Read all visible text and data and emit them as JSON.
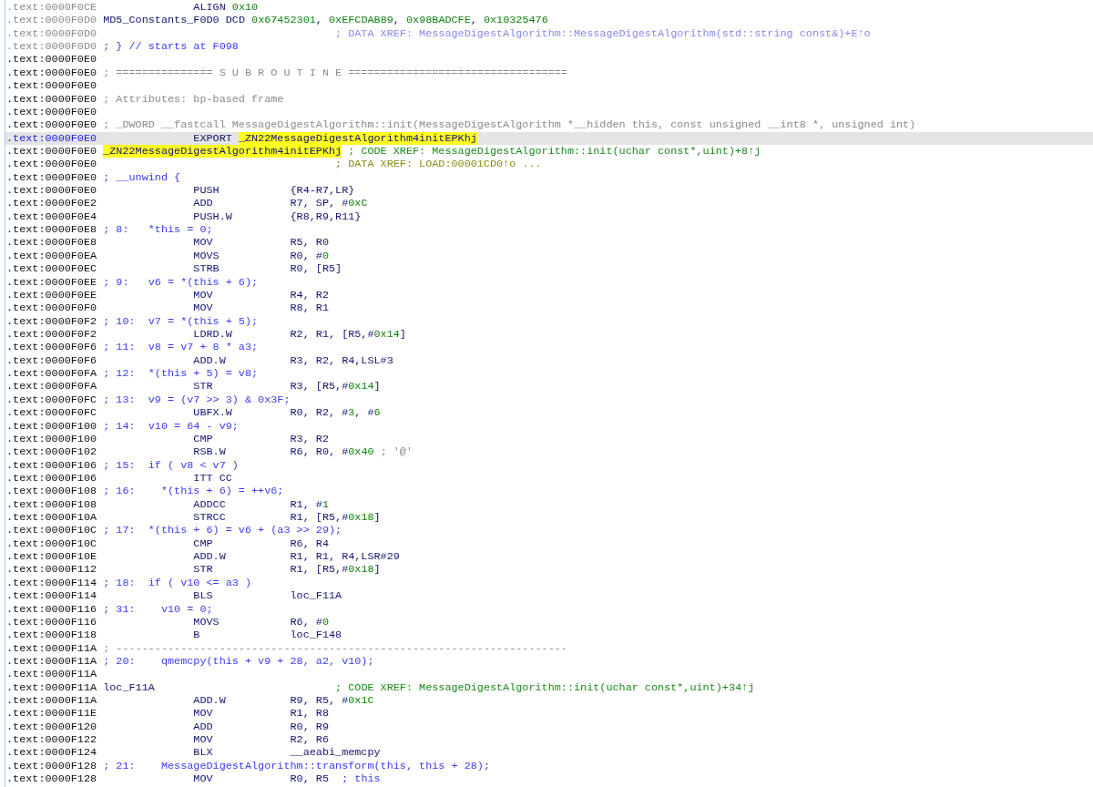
{
  "listing": {
    "lines": [
      {
        "address": ".text:0000F0CE",
        "dimmed": true,
        "selected": false,
        "parts": [
          {
            "kind": "directive",
            "text": "ALIGN"
          },
          {
            "kind": "data",
            "tokens": [
              {
                "kind": "num",
                "text": "0x10"
              }
            ]
          }
        ]
      },
      {
        "address": ".text:0000F0D0",
        "dimmed": true,
        "selected": false,
        "parts": [
          {
            "kind": "label",
            "text": "MD5_Constants_F0D0"
          },
          {
            "kind": "data",
            "tokens": [
              {
                "kind": "reg",
                "text": "DCD "
              },
              {
                "kind": "num",
                "text": "0x67452301"
              },
              {
                "kind": "reg",
                "text": ", "
              },
              {
                "kind": "num",
                "text": "0xEFCDAB89"
              },
              {
                "kind": "reg",
                "text": ", "
              },
              {
                "kind": "num",
                "text": "0x98BADCFE"
              },
              {
                "kind": "reg",
                "text": ", "
              },
              {
                "kind": "num",
                "text": "0x10325476"
              }
            ]
          }
        ]
      },
      {
        "address": ".text:0000F0D0",
        "dimmed": true,
        "selected": false,
        "parts": [
          {
            "kind": "xref-dim",
            "text": "; DATA XREF: MessageDigestAlgorithm::MessageDigestAlgorithm(std::string const&)+E↑o"
          }
        ]
      },
      {
        "address": ".text:0000F0D0",
        "dimmed": true,
        "selected": false,
        "parts": [
          {
            "kind": "pseudo",
            "text": "; } // starts at F098"
          }
        ]
      },
      {
        "address": ".text:0000F0E0",
        "dimmed": false,
        "selected": false
      },
      {
        "address": ".text:0000F0E0",
        "dimmed": false,
        "selected": false,
        "parts": [
          {
            "kind": "note",
            "text": "; =============== S U B R O U T I N E =================================="
          }
        ]
      },
      {
        "address": ".text:0000F0E0",
        "dimmed": false,
        "selected": false
      },
      {
        "address": ".text:0000F0E0",
        "dimmed": false,
        "selected": false,
        "parts": [
          {
            "kind": "note",
            "text": "; Attributes: bp-based frame"
          }
        ]
      },
      {
        "address": ".text:0000F0E0",
        "dimmed": false,
        "selected": false
      },
      {
        "address": ".text:0000F0E0",
        "dimmed": false,
        "selected": false,
        "parts": [
          {
            "kind": "note",
            "text": "; _DWORD __fastcall MessageDigestAlgorithm::init(MessageDigestAlgorithm *__hidden this, const unsigned __int8 *, unsigned int)"
          }
        ]
      },
      {
        "address": ".text:0000F0E0",
        "dimmed": false,
        "selected": true,
        "parts": [
          {
            "kind": "directive",
            "text": "EXPORT"
          },
          {
            "kind": "highlight",
            "text": "_ZN22MessageDigestAlgorithm4initEPKhj"
          }
        ]
      },
      {
        "address": ".text:0000F0E0",
        "dimmed": false,
        "selected": false,
        "parts": [
          {
            "kind": "highlight-label",
            "text": "_ZN22MessageDigestAlgorithm4initEPKhj"
          },
          {
            "kind": "xref",
            "text": "; CODE XREF: MessageDigestAlgorithm::init(uchar const*,uint)+8↑j"
          }
        ]
      },
      {
        "address": ".text:0000F0E0",
        "dimmed": false,
        "selected": false,
        "parts": [
          {
            "kind": "xref-data",
            "text": "; DATA XREF: LOAD:00001CD0↑o ..."
          }
        ]
      },
      {
        "address": ".text:0000F0E0",
        "dimmed": false,
        "selected": false,
        "parts": [
          {
            "kind": "pseudo",
            "text": "; __unwind {"
          }
        ]
      },
      {
        "address": ".text:0000F0E0",
        "dimmed": false,
        "selected": false,
        "parts": [
          {
            "kind": "mnemonic",
            "text": "PUSH"
          },
          {
            "kind": "operands",
            "tokens": [
              {
                "kind": "reg",
                "text": "{R4-R7,LR}"
              }
            ]
          }
        ]
      },
      {
        "address": ".text:0000F0E2",
        "dimmed": false,
        "selected": false,
        "parts": [
          {
            "kind": "mnemonic",
            "text": "ADD"
          },
          {
            "kind": "operands",
            "tokens": [
              {
                "kind": "reg",
                "text": "R7, SP, #"
              },
              {
                "kind": "num",
                "text": "0xC"
              }
            ]
          }
        ]
      },
      {
        "address": ".text:0000F0E4",
        "dimmed": false,
        "selected": false,
        "parts": [
          {
            "kind": "mnemonic",
            "text": "PUSH.W"
          },
          {
            "kind": "operands",
            "tokens": [
              {
                "kind": "reg",
                "text": "{R8,R9,R11}"
              }
            ]
          }
        ]
      },
      {
        "address": ".text:0000F0E8",
        "dimmed": false,
        "selected": false,
        "parts": [
          {
            "kind": "pseudo",
            "text": "; 8:   *this = 0;"
          }
        ]
      },
      {
        "address": ".text:0000F0E8",
        "dimmed": false,
        "selected": false,
        "parts": [
          {
            "kind": "mnemonic",
            "text": "MOV"
          },
          {
            "kind": "operands",
            "tokens": [
              {
                "kind": "reg",
                "text": "R5, R0"
              }
            ]
          }
        ]
      },
      {
        "address": ".text:0000F0EA",
        "dimmed": false,
        "selected": false,
        "parts": [
          {
            "kind": "mnemonic",
            "text": "MOVS"
          },
          {
            "kind": "operands",
            "tokens": [
              {
                "kind": "reg",
                "text": "R0, #"
              },
              {
                "kind": "num",
                "text": "0"
              }
            ]
          }
        ]
      },
      {
        "address": ".text:0000F0EC",
        "dimmed": false,
        "selected": false,
        "parts": [
          {
            "kind": "mnemonic",
            "text": "STRB"
          },
          {
            "kind": "operands",
            "tokens": [
              {
                "kind": "reg",
                "text": "R0, [R5]"
              }
            ]
          }
        ]
      },
      {
        "address": ".text:0000F0EE",
        "dimmed": false,
        "selected": false,
        "parts": [
          {
            "kind": "pseudo",
            "text": "; 9:   v6 = *(this + 6);"
          }
        ]
      },
      {
        "address": ".text:0000F0EE",
        "dimmed": false,
        "selected": false,
        "parts": [
          {
            "kind": "mnemonic",
            "text": "MOV"
          },
          {
            "kind": "operands",
            "tokens": [
              {
                "kind": "reg",
                "text": "R4, R2"
              }
            ]
          }
        ]
      },
      {
        "address": ".text:0000F0F0",
        "dimmed": false,
        "selected": false,
        "parts": [
          {
            "kind": "mnemonic",
            "text": "MOV"
          },
          {
            "kind": "operands",
            "tokens": [
              {
                "kind": "reg",
                "text": "R8, R1"
              }
            ]
          }
        ]
      },
      {
        "address": ".text:0000F0F2",
        "dimmed": false,
        "selected": false,
        "parts": [
          {
            "kind": "pseudo",
            "text": "; 10:  v7 = *(this + 5);"
          }
        ]
      },
      {
        "address": ".text:0000F0F2",
        "dimmed": false,
        "selected": false,
        "parts": [
          {
            "kind": "mnemonic",
            "text": "LDRD.W"
          },
          {
            "kind": "operands",
            "tokens": [
              {
                "kind": "reg",
                "text": "R2, R1, [R5,#"
              },
              {
                "kind": "num",
                "text": "0x14"
              },
              {
                "kind": "reg",
                "text": "]"
              }
            ]
          }
        ]
      },
      {
        "address": ".text:0000F0F6",
        "dimmed": false,
        "selected": false,
        "parts": [
          {
            "kind": "pseudo",
            "text": "; 11:  v8 = v7 + 8 * a3;"
          }
        ]
      },
      {
        "address": ".text:0000F0F6",
        "dimmed": false,
        "selected": false,
        "parts": [
          {
            "kind": "mnemonic",
            "text": "ADD.W"
          },
          {
            "kind": "operands",
            "tokens": [
              {
                "kind": "reg",
                "text": "R3, R2, R4,LSL#3"
              }
            ]
          }
        ]
      },
      {
        "address": ".text:0000F0FA",
        "dimmed": false,
        "selected": false,
        "parts": [
          {
            "kind": "pseudo",
            "text": "; 12:  *(this + 5) = v8;"
          }
        ]
      },
      {
        "address": ".text:0000F0FA",
        "dimmed": false,
        "selected": false,
        "parts": [
          {
            "kind": "mnemonic",
            "text": "STR"
          },
          {
            "kind": "operands",
            "tokens": [
              {
                "kind": "reg",
                "text": "R3, [R5,#"
              },
              {
                "kind": "num",
                "text": "0x14"
              },
              {
                "kind": "reg",
                "text": "]"
              }
            ]
          }
        ]
      },
      {
        "address": ".text:0000F0FC",
        "dimmed": false,
        "selected": false,
        "parts": [
          {
            "kind": "pseudo",
            "text": "; 13:  v9 = (v7 >> 3) & 0x3F;"
          }
        ]
      },
      {
        "address": ".text:0000F0FC",
        "dimmed": false,
        "selected": false,
        "parts": [
          {
            "kind": "mnemonic",
            "text": "UBFX.W"
          },
          {
            "kind": "operands",
            "tokens": [
              {
                "kind": "reg",
                "text": "R0, R2, #"
              },
              {
                "kind": "num",
                "text": "3"
              },
              {
                "kind": "reg",
                "text": ", #"
              },
              {
                "kind": "num",
                "text": "6"
              }
            ]
          }
        ]
      },
      {
        "address": ".text:0000F100",
        "dimmed": false,
        "selected": false,
        "parts": [
          {
            "kind": "pseudo",
            "text": "; 14:  v10 = 64 - v9;"
          }
        ]
      },
      {
        "address": ".text:0000F100",
        "dimmed": false,
        "selected": false,
        "parts": [
          {
            "kind": "mnemonic",
            "text": "CMP"
          },
          {
            "kind": "operands",
            "tokens": [
              {
                "kind": "reg",
                "text": "R3, R2"
              }
            ]
          }
        ]
      },
      {
        "address": ".text:0000F102",
        "dimmed": false,
        "selected": false,
        "parts": [
          {
            "kind": "mnemonic",
            "text": "RSB.W"
          },
          {
            "kind": "operands",
            "tokens": [
              {
                "kind": "reg",
                "text": "R6, R0, #"
              },
              {
                "kind": "num",
                "text": "0x40"
              }
            ]
          },
          {
            "kind": "note",
            "text": "; '@'"
          }
        ]
      },
      {
        "address": ".text:0000F106",
        "dimmed": false,
        "selected": false,
        "parts": [
          {
            "kind": "pseudo",
            "text": "; 15:  if ( v8 < v7 )"
          }
        ]
      },
      {
        "address": ".text:0000F106",
        "dimmed": false,
        "selected": false,
        "parts": [
          {
            "kind": "mnemonic",
            "text": "ITT CC"
          }
        ]
      },
      {
        "address": ".text:0000F108",
        "dimmed": false,
        "selected": false,
        "parts": [
          {
            "kind": "pseudo",
            "text": "; 16:    *(this + 6) = ++v6;"
          }
        ]
      },
      {
        "address": ".text:0000F108",
        "dimmed": false,
        "selected": false,
        "parts": [
          {
            "kind": "mnemonic",
            "text": "ADDCC"
          },
          {
            "kind": "operands",
            "tokens": [
              {
                "kind": "reg",
                "text": "R1, #"
              },
              {
                "kind": "num",
                "text": "1"
              }
            ]
          }
        ]
      },
      {
        "address": ".text:0000F10A",
        "dimmed": false,
        "selected": false,
        "parts": [
          {
            "kind": "mnemonic",
            "text": "STRCC"
          },
          {
            "kind": "operands",
            "tokens": [
              {
                "kind": "reg",
                "text": "R1, [R5,#"
              },
              {
                "kind": "num",
                "text": "0x18"
              },
              {
                "kind": "reg",
                "text": "]"
              }
            ]
          }
        ]
      },
      {
        "address": ".text:0000F10C",
        "dimmed": false,
        "selected": false,
        "parts": [
          {
            "kind": "pseudo",
            "text": "; 17:  *(this + 6) = v6 + (a3 >> 29);"
          }
        ]
      },
      {
        "address": ".text:0000F10C",
        "dimmed": false,
        "selected": false,
        "parts": [
          {
            "kind": "mnemonic",
            "text": "CMP"
          },
          {
            "kind": "operands",
            "tokens": [
              {
                "kind": "reg",
                "text": "R6, R4"
              }
            ]
          }
        ]
      },
      {
        "address": ".text:0000F10E",
        "dimmed": false,
        "selected": false,
        "parts": [
          {
            "kind": "mnemonic",
            "text": "ADD.W"
          },
          {
            "kind": "operands",
            "tokens": [
              {
                "kind": "reg",
                "text": "R1, R1, R4,LSR#29"
              }
            ]
          }
        ]
      },
      {
        "address": ".text:0000F112",
        "dimmed": false,
        "selected": false,
        "parts": [
          {
            "kind": "mnemonic",
            "text": "STR"
          },
          {
            "kind": "operands",
            "tokens": [
              {
                "kind": "reg",
                "text": "R1, [R5,#"
              },
              {
                "kind": "num",
                "text": "0x18"
              },
              {
                "kind": "reg",
                "text": "]"
              }
            ]
          }
        ]
      },
      {
        "address": ".text:0000F114",
        "dimmed": false,
        "selected": false,
        "parts": [
          {
            "kind": "pseudo",
            "text": "; 18:  if ( v10 <= a3 )"
          }
        ]
      },
      {
        "address": ".text:0000F114",
        "dimmed": false,
        "selected": false,
        "parts": [
          {
            "kind": "mnemonic",
            "text": "BLS"
          },
          {
            "kind": "operands",
            "tokens": [
              {
                "kind": "reg",
                "text": "loc_F11A"
              }
            ]
          }
        ]
      },
      {
        "address": ".text:0000F116",
        "dimmed": false,
        "selected": false,
        "parts": [
          {
            "kind": "pseudo",
            "text": "; 31:    v10 = 0;"
          }
        ]
      },
      {
        "address": ".text:0000F116",
        "dimmed": false,
        "selected": false,
        "parts": [
          {
            "kind": "mnemonic",
            "text": "MOVS"
          },
          {
            "kind": "operands",
            "tokens": [
              {
                "kind": "reg",
                "text": "R6, #"
              },
              {
                "kind": "num",
                "text": "0"
              }
            ]
          }
        ]
      },
      {
        "address": ".text:0000F118",
        "dimmed": false,
        "selected": false,
        "parts": [
          {
            "kind": "mnemonic",
            "text": "B"
          },
          {
            "kind": "operands",
            "tokens": [
              {
                "kind": "reg",
                "text": "loc_F148"
              }
            ]
          }
        ]
      },
      {
        "address": ".text:0000F11A",
        "dimmed": false,
        "selected": false,
        "parts": [
          {
            "kind": "note",
            "text": "; ----------------------------------------------------------------------"
          }
        ]
      },
      {
        "address": ".text:0000F11A",
        "dimmed": false,
        "selected": false,
        "parts": [
          {
            "kind": "pseudo",
            "text": "; 20:    qmemcpy(this + v9 + 28, a2, v10);"
          }
        ]
      },
      {
        "address": ".text:0000F11A",
        "dimmed": false,
        "selected": false
      },
      {
        "address": ".text:0000F11A",
        "dimmed": false,
        "selected": false,
        "parts": [
          {
            "kind": "label",
            "text": "loc_F11A"
          },
          {
            "kind": "xref",
            "text": "; CODE XREF: MessageDigestAlgorithm::init(uchar const*,uint)+34↑j"
          }
        ]
      },
      {
        "address": ".text:0000F11A",
        "dimmed": false,
        "selected": false,
        "parts": [
          {
            "kind": "mnemonic",
            "text": "ADD.W"
          },
          {
            "kind": "operands",
            "tokens": [
              {
                "kind": "reg",
                "text": "R9, R5, #"
              },
              {
                "kind": "num",
                "text": "0x1C"
              }
            ]
          }
        ]
      },
      {
        "address": ".text:0000F11E",
        "dimmed": false,
        "selected": false,
        "parts": [
          {
            "kind": "mnemonic",
            "text": "MOV"
          },
          {
            "kind": "operands",
            "tokens": [
              {
                "kind": "reg",
                "text": "R1, R8"
              }
            ]
          }
        ]
      },
      {
        "address": ".text:0000F120",
        "dimmed": false,
        "selected": false,
        "parts": [
          {
            "kind": "mnemonic",
            "text": "ADD"
          },
          {
            "kind": "operands",
            "tokens": [
              {
                "kind": "reg",
                "text": "R0, R9"
              }
            ]
          }
        ]
      },
      {
        "address": ".text:0000F122",
        "dimmed": false,
        "selected": false,
        "parts": [
          {
            "kind": "mnemonic",
            "text": "MOV"
          },
          {
            "kind": "operands",
            "tokens": [
              {
                "kind": "reg",
                "text": "R2, R6"
              }
            ]
          }
        ]
      },
      {
        "address": ".text:0000F124",
        "dimmed": false,
        "selected": false,
        "parts": [
          {
            "kind": "mnemonic",
            "text": "BLX"
          },
          {
            "kind": "operands",
            "tokens": [
              {
                "kind": "reg",
                "text": "__aeabi_memcpy"
              }
            ]
          }
        ]
      },
      {
        "address": ".text:0000F128",
        "dimmed": false,
        "selected": false,
        "parts": [
          {
            "kind": "pseudo",
            "text": "; 21:    MessageDigestAlgorithm::transform(this, this + 28);"
          }
        ]
      },
      {
        "address": ".text:0000F128",
        "dimmed": false,
        "selected": false,
        "parts": [
          {
            "kind": "mnemonic",
            "text": "MOV"
          },
          {
            "kind": "operands",
            "tokens": [
              {
                "kind": "reg",
                "text": "R0, R5"
              }
            ]
          },
          {
            "kind": "pseudo-inline",
            "text": "; this"
          }
        ]
      }
    ]
  }
}
